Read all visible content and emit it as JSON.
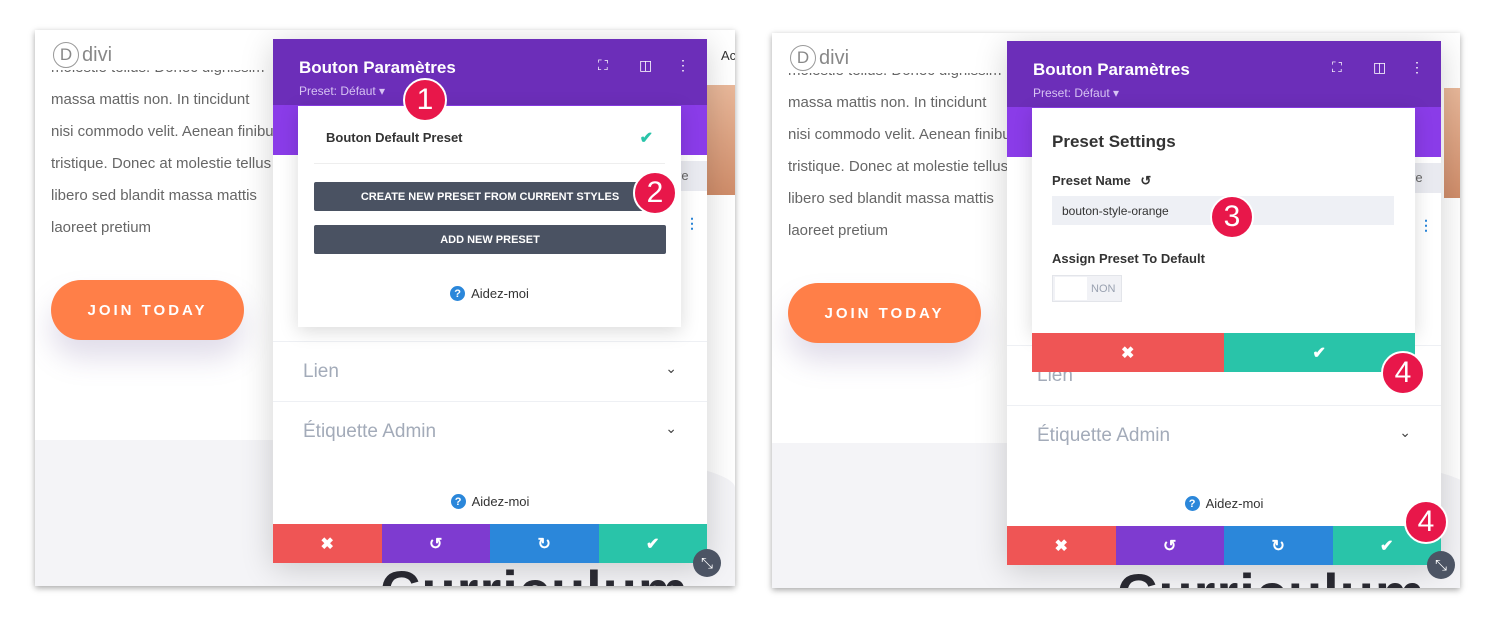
{
  "colors": {
    "purple_header": "#6c2eb9",
    "purple_tabs": "#8a3ce8",
    "cancel": "#ef5555",
    "undo": "#7e3bd0",
    "redo": "#2b87da",
    "save": "#29c4a9",
    "badge": "#e8174a",
    "join_button": "#ff7f48",
    "dark_button": "#4a5262"
  },
  "page": {
    "logo": "divi",
    "lorem_lines": [
      "molestie tellus. Donec dignissim",
      "massa mattis non. In tincidunt",
      "nisi commodo velit. Aenean finibus",
      "tristique. Donec at molestie tellus",
      "libero sed blandit massa mattis",
      "laoreet pretium"
    ],
    "join_button": "JOIN TODAY",
    "nav_partial": "Ac",
    "heading_partial": "Curriculum"
  },
  "modal": {
    "title": "Bouton Paramètres",
    "preset": "Preset: Défaut ▾",
    "header_icons": [
      "fullscreen-icon",
      "split-view-icon",
      "more-vertical-icon"
    ],
    "partial_tab": "re",
    "rows": [
      {
        "label": "Lien"
      },
      {
        "label": "Étiquette Admin"
      }
    ],
    "help": "Aidez-moi",
    "footer_icons": [
      "close-icon",
      "undo-icon",
      "redo-icon",
      "check-icon"
    ]
  },
  "dropdown": {
    "item": "Bouton Default Preset",
    "create_button": "CREATE NEW PRESET FROM CURRENT STYLES",
    "add_button": "ADD NEW PRESET",
    "help": "Aidez-moi"
  },
  "preset_settings": {
    "title": "Preset Settings",
    "name_label": "Preset Name",
    "name_value": "bouton-style-orange",
    "assign_label": "Assign Preset To Default",
    "toggle_label": "NON",
    "toggle_on": false
  },
  "badges": [
    "1",
    "2",
    "3",
    "4",
    "4"
  ]
}
